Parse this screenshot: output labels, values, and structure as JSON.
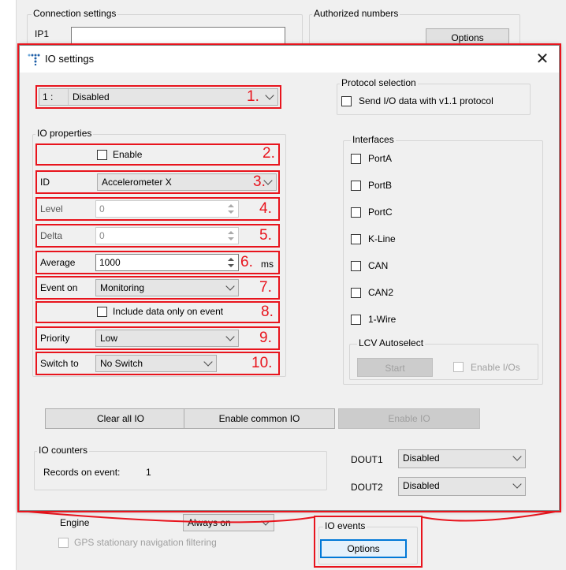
{
  "background": {
    "connection_settings_title": "Connection settings",
    "ip1_label": "IP1",
    "authorized_numbers_title": "Authorized numbers",
    "options_label": "Options",
    "engine_label": "Engine",
    "engine_value": "Always on",
    "gps_filter_label": "GPS stationary navigation filtering",
    "io_events_title": "IO events",
    "io_events_options_label": "Options"
  },
  "dialog": {
    "title": "IO settings",
    "close_glyph": "✕",
    "io_select": {
      "index": "1 :",
      "value": "Disabled"
    },
    "protocol_selection": {
      "title": "Protocol selection",
      "checkbox_label": "Send I/O data with v1.1 protocol"
    },
    "io_properties": {
      "title": "IO properties",
      "enable_label": "Enable",
      "id_label": "ID",
      "id_value": "Accelerometer X",
      "level_label": "Level",
      "level_value": "0",
      "delta_label": "Delta",
      "delta_value": "0",
      "average_label": "Average",
      "average_value": "1000",
      "average_unit": "ms",
      "event_on_label": "Event on",
      "event_on_value": "Monitoring",
      "include_data_label": "Include data only on event",
      "priority_label": "Priority",
      "priority_value": "Low",
      "switch_to_label": "Switch to",
      "switch_to_value": "No Switch"
    },
    "annotations": [
      "1.",
      "2.",
      "3.",
      "4.",
      "5.",
      "6.",
      "7.",
      "8.",
      "9.",
      "10."
    ],
    "interfaces": {
      "title": "Interfaces",
      "items": [
        "PortA",
        "PortB",
        "PortC",
        "K-Line",
        "CAN",
        "CAN2",
        "1-Wire"
      ]
    },
    "lcv_autoselect": {
      "title": "LCV Autoselect",
      "start_label": "Start",
      "enable_ios_label": "Enable I/Os"
    },
    "buttons": {
      "clear_all": "Clear all IO",
      "enable_common": "Enable common IO",
      "enable_io": "Enable IO"
    },
    "io_counters": {
      "title": "IO counters",
      "records_label": "Records on event:",
      "records_value": "1"
    },
    "dout1": {
      "label": "DOUT1",
      "value": "Disabled"
    },
    "dout2": {
      "label": "DOUT2",
      "value": "Disabled"
    }
  },
  "colors": {
    "highlight_red": "#e8141d",
    "focus_blue": "#0078d7",
    "dialog_bg": "#f0f0f0"
  }
}
